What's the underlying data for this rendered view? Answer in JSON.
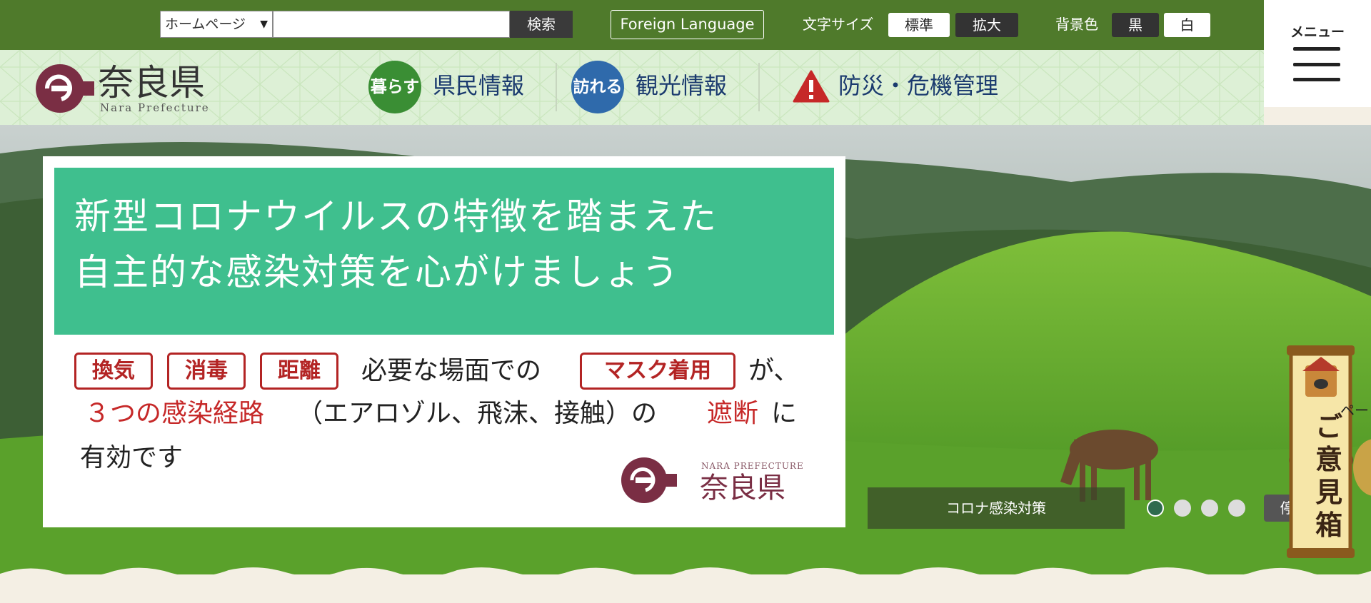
{
  "topbar": {
    "scope_select": "ホームページ",
    "search_input_value": "",
    "search_button": "検索",
    "foreign_language": "Foreign Language",
    "font_size_label": "文字サイズ",
    "font_standard": "標準",
    "font_large": "拡大",
    "bg_color_label": "背景色",
    "bg_black": "黒",
    "bg_white": "白",
    "menu": "メニュー"
  },
  "header": {
    "logo_title": "奈良県",
    "logo_subtitle": "Nara Prefecture",
    "nav": [
      {
        "badge": "暮らす",
        "label": "県民情報",
        "color": "#3a8e34"
      },
      {
        "badge": "訪れる",
        "label": "観光情報",
        "color": "#2f6aab"
      },
      {
        "badge": "",
        "label": "防災・危機管理",
        "color": "#c62828"
      }
    ]
  },
  "slide": {
    "heading_line1": "新型コロナウイルスの特徴を踏まえた",
    "heading_line2": "自主的な感染対策を心がけましょう",
    "tags": [
      "換気",
      "消毒",
      "距離"
    ],
    "text_a": "必要な場面での",
    "tag_mask": "マスク着用",
    "text_b": "が、",
    "red_a": "３つの感染経路",
    "text_c": "（エアロゾル、飛沫、接触）の",
    "red_b": "遮断",
    "text_d": "に",
    "text_e": "有効です",
    "brand_en": "NARA PREFECTURE",
    "brand_jp": "奈良県"
  },
  "carousel": {
    "caption": "コロナ感染対策",
    "dots": 4,
    "active_dot": 1,
    "stop": "停止"
  },
  "side": {
    "opinion_box": "ご意見箱",
    "page_top_partial": "ペー"
  },
  "colors": {
    "topbar": "#4f7a2b",
    "nav_bg": "#ddf0d6",
    "slide_head": "#3fbf8e",
    "accent_red": "#c62828",
    "logo_maroon": "#7a2e44"
  }
}
